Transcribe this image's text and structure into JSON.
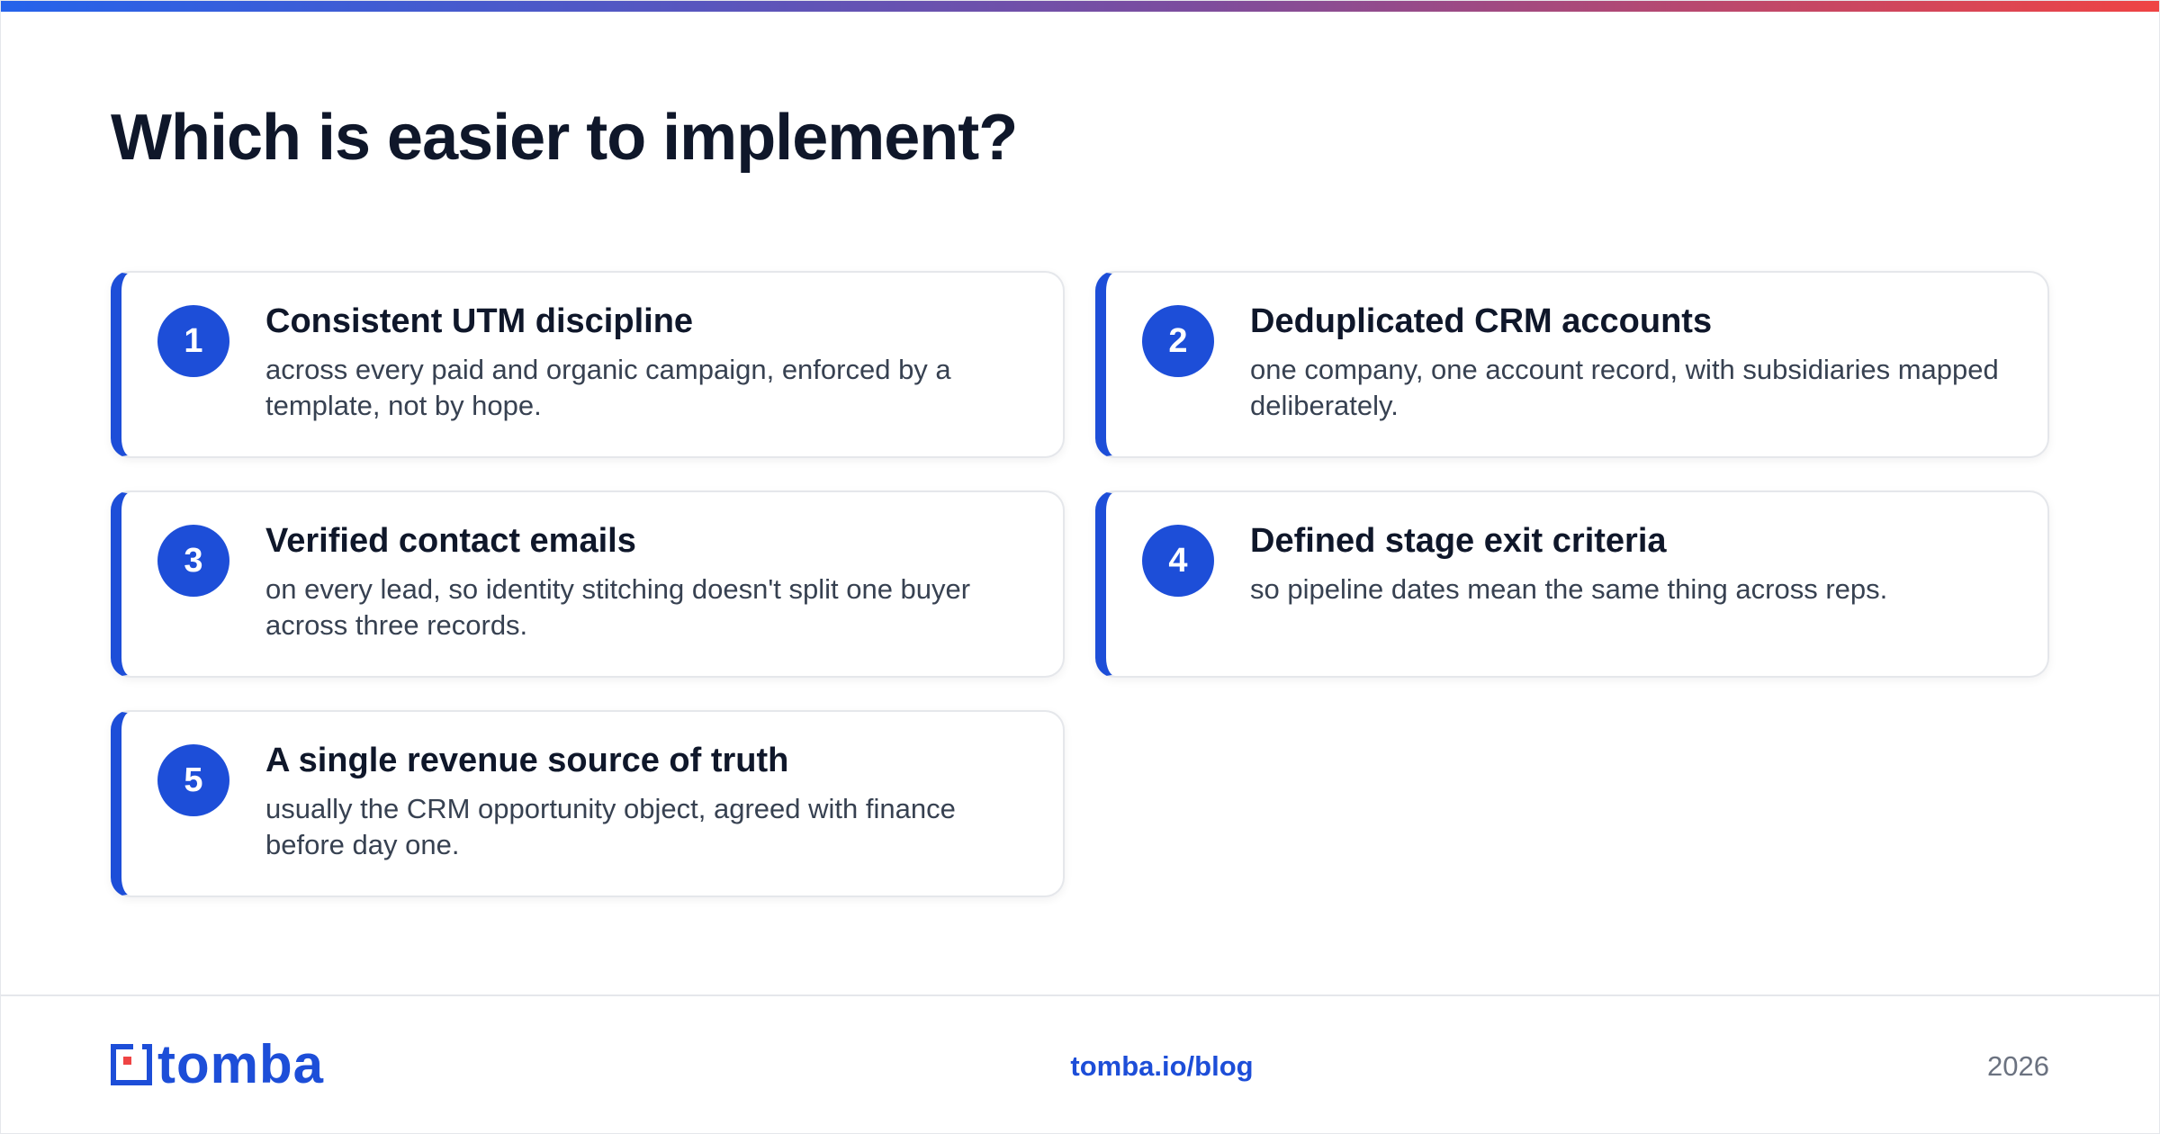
{
  "title": "Which is easier to implement?",
  "items": [
    {
      "number": "1",
      "title": "Consistent UTM discipline",
      "description": "across every paid and organic campaign, enforced by a template, not by hope."
    },
    {
      "number": "2",
      "title": "Deduplicated CRM accounts",
      "description": "one company, one account record, with subsidiaries mapped deliberately."
    },
    {
      "number": "3",
      "title": "Verified contact emails",
      "description": "on every lead, so identity stitching doesn't split one buyer across three records."
    },
    {
      "number": "4",
      "title": "Defined stage exit criteria",
      "description": "so pipeline dates mean the same thing across reps."
    },
    {
      "number": "5",
      "title": "A single revenue source of truth",
      "description": "usually the CRM opportunity object, agreed with finance before day one."
    }
  ],
  "footer": {
    "logo_text": "tomba",
    "link": "tomba.io/blog",
    "year": "2026"
  },
  "colors": {
    "accent": "#1d4ed8",
    "title": "#0f172a",
    "body_text": "#374151",
    "muted": "#6b7280",
    "logo_red": "#ef4444"
  },
  "icons": {
    "logo_mark": "tomba-logo-icon"
  }
}
